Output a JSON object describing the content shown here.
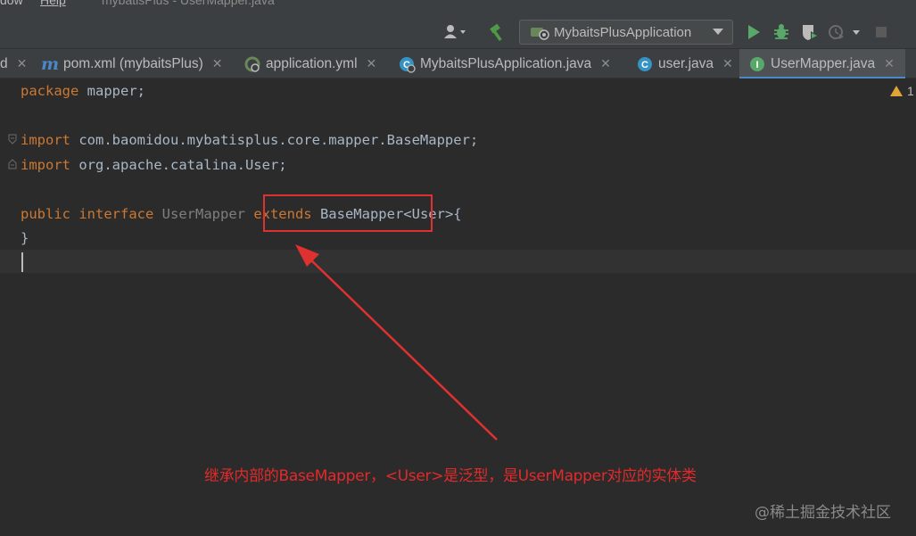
{
  "menu": {
    "items": [
      {
        "label": "dow"
      },
      {
        "label": "Help"
      }
    ],
    "window_title": "mybatisPlus - UserMapper.java"
  },
  "toolbar": {
    "run_config": "MybaitsPlusApplication",
    "icons": [
      "user-icon",
      "build-hammer-icon",
      "run-icon",
      "debug-icon",
      "coverage-icon",
      "profile-icon",
      "stop-icon"
    ]
  },
  "tabs": [
    {
      "label": "d",
      "icon": "none",
      "active": false
    },
    {
      "label": "pom.xml (mybaitsPlus)",
      "icon": "maven-icon",
      "active": false
    },
    {
      "label": "application.yml",
      "icon": "spring-config-icon",
      "active": false
    },
    {
      "label": "MybaitsPlusApplication.java",
      "icon": "spring-boot-class-icon",
      "active": false
    },
    {
      "label": "user.java",
      "icon": "class-icon",
      "active": false
    },
    {
      "label": "UserMapper.java",
      "icon": "interface-icon",
      "active": true
    }
  ],
  "editor": {
    "warning_count": "1",
    "lines": {
      "l1_kw": "package",
      "l1_rest": " mapper;",
      "l3_kw": "import",
      "l3_rest": " com.baomidou.mybatisplus.core.mapper.BaseMapper;",
      "l4_kw": "import",
      "l4_rest": " org.apache.catalina.User;",
      "l6_kw1": "public",
      "l6_kw2": " interface",
      "l6_name": " UserMapper",
      "l6_kw3": " extends",
      "l6_rest": " BaseMapper<User>{",
      "l7": "}"
    }
  },
  "annotation": {
    "text": "继承内部的BaseMapper，<User>是泛型，是UserMapper对应的实体类",
    "color": "#e32a2a"
  },
  "watermark": "@稀土掘金技术社区",
  "colors": {
    "keyword": "#cc7832",
    "identifier": "#a9b7c6",
    "unused": "#7f7f7f",
    "tab_active_underline": "#4a88c7",
    "annotation_red": "#e03131"
  }
}
